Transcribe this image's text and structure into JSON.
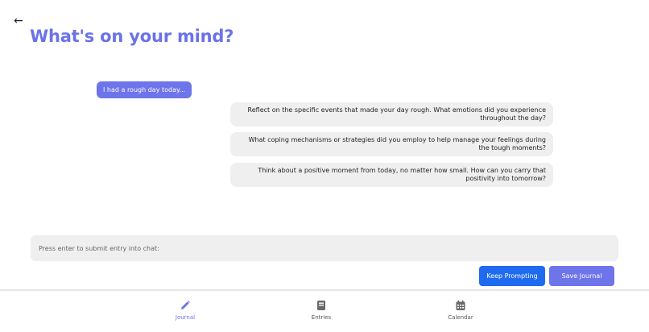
{
  "header": {
    "back_icon": "arrow-left-icon",
    "title": "What's on your mind?"
  },
  "chat": {
    "user_message": "I had a rough day today...",
    "prompts": [
      "Reflect on the specific events that made your day rough. What emotions did you experience throughout the day?",
      "What coping mechanisms or strategies did you employ to help manage your feelings during the tough moments?",
      "Think about a positive moment from today, no matter how small. How can you carry that positivity into tomorrow?"
    ]
  },
  "entry": {
    "placeholder": "Press enter to submit entry into chat:",
    "value": ""
  },
  "actions": {
    "keep_prompting_label": "Keep Prompting",
    "save_journal_label": "Save Journal"
  },
  "nav": {
    "items": [
      {
        "label": "Journal",
        "icon": "pencil-icon",
        "active": true
      },
      {
        "label": "Entries",
        "icon": "book-icon",
        "active": false
      },
      {
        "label": "Calendar",
        "icon": "calendar-icon",
        "active": false
      }
    ]
  },
  "colors": {
    "accent": "#6b72e8",
    "button_blue": "#1f6bf0",
    "bubble_bg": "#efefef"
  }
}
